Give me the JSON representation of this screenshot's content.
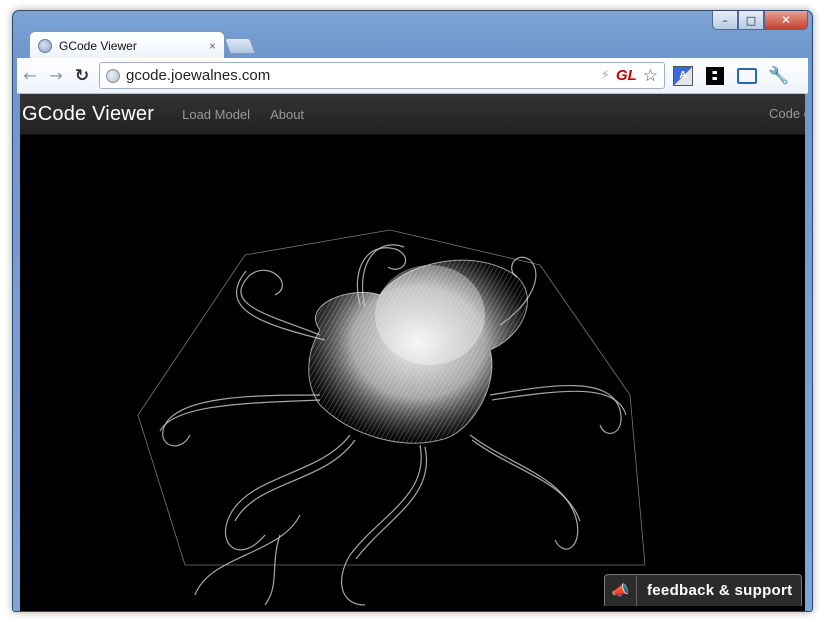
{
  "browser": {
    "tab_title": "GCode Viewer",
    "tab_close": "×",
    "url": "gcode.joewalnes.com",
    "gl_badge": "GL",
    "caption": {
      "minimize": "–",
      "maximize": "□",
      "close": "✕"
    },
    "icons": [
      "back-icon",
      "forward-icon",
      "reload-icon",
      "globe-icon",
      "lightning-icon",
      "star-icon",
      "translate-icon",
      "qr-code-icon",
      "fullscreen-icon",
      "wrench-icon"
    ]
  },
  "navbar": {
    "brand": "GCode Viewer",
    "links": [
      "Load Model",
      "About"
    ],
    "right_link": "Code on"
  },
  "feedback": {
    "label": "feedback & support"
  },
  "colors": {
    "navbar": "#2b2b2b",
    "viewer_bg": "#000000",
    "wire": "#ffffff",
    "window_frame": "#7ea4d3"
  }
}
